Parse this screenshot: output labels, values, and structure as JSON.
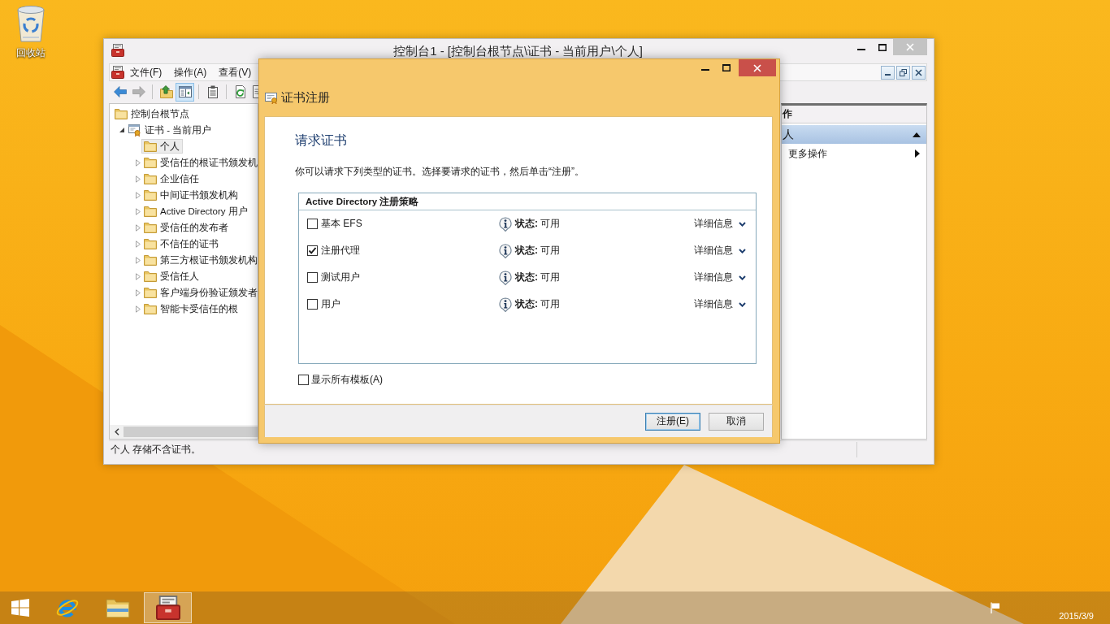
{
  "desktop": {
    "icons": [
      {
        "kind": "recycle_bin",
        "label": "回收站"
      }
    ]
  },
  "mmc_window": {
    "title": "控制台1 - [控制台根节点\\证书 - 当前用户\\个人]",
    "menu": [
      "文件(F)",
      "操作(A)",
      "查看(V)"
    ],
    "toolbar": [
      {
        "buttons": [
          {
            "kind": "back",
            "disabled": false,
            "pressed": false
          },
          {
            "kind": "forward",
            "disabled": true,
            "pressed": false
          }
        ]
      },
      {
        "buttons": [
          {
            "kind": "up",
            "disabled": false,
            "pressed": false
          },
          {
            "kind": "tree",
            "disabled": false,
            "pressed": true
          }
        ]
      },
      {
        "buttons": [
          {
            "kind": "properties",
            "disabled": false,
            "pressed": false
          }
        ]
      },
      {
        "buttons": [
          {
            "kind": "refresh",
            "disabled": false,
            "pressed": false
          },
          {
            "kind": "export",
            "disabled": false,
            "pressed": false
          }
        ]
      }
    ],
    "tree": [
      {
        "kind": "folder",
        "label": "控制台根节点",
        "selected": false,
        "children": [
          {
            "kind": "certificates",
            "label": "证书 - 当前用户",
            "expanded": true,
            "selected": false,
            "children": [
              {
                "kind": "folder",
                "label": "个人",
                "selected": true
              },
              {
                "kind": "folder",
                "label": "受信任的根证书颁发机",
                "expanded": false,
                "selected": false
              },
              {
                "kind": "folder",
                "label": "企业信任",
                "expanded": false,
                "selected": false
              },
              {
                "kind": "folder",
                "label": "中间证书颁发机构",
                "expanded": false,
                "selected": false
              },
              {
                "kind": "folder",
                "label": "Active Directory 用户",
                "expanded": false,
                "selected": false
              },
              {
                "kind": "folder",
                "label": "受信任的发布者",
                "expanded": false,
                "selected": false
              },
              {
                "kind": "folder",
                "label": "不信任的证书",
                "expanded": false,
                "selected": false
              },
              {
                "kind": "folder",
                "label": "第三方根证书颁发机构",
                "expanded": false,
                "selected": false
              },
              {
                "kind": "folder",
                "label": "受信任人",
                "expanded": false,
                "selected": false
              },
              {
                "kind": "folder",
                "label": "客户端身份验证颁发者",
                "expanded": false,
                "selected": false
              },
              {
                "kind": "folder",
                "label": "智能卡受信任的根",
                "expanded": false,
                "selected": false
              }
            ]
          }
        ]
      }
    ],
    "status": "个人 存储不含证书。",
    "actions": {
      "header": "作",
      "groups": [
        {
          "title": "人",
          "expanded": true,
          "items": [
            {
              "label": "更多操作",
              "submenu": true
            }
          ]
        }
      ]
    }
  },
  "dialog": {
    "title": "证书注册",
    "heading": "请求证书",
    "description": "你可以请求下列类型的证书。选择要请求的证书，然后单击“注册”。",
    "policy": "Active Directory 注册策略",
    "templates": [
      {
        "name": "基本 EFS",
        "checked": false,
        "status": "**状态:** 可用",
        "details": "详细信息"
      },
      {
        "name": "注册代理",
        "checked": true,
        "status": "**状态:** 可用",
        "details": "详细信息"
      },
      {
        "name": "测试用户",
        "checked": false,
        "status": "**状态:** 可用",
        "details": "详细信息"
      },
      {
        "name": "用户",
        "checked": false,
        "status": "**状态:** 可用",
        "details": "详细信息"
      }
    ],
    "show_all": {
      "label": "显示所有模板(A)",
      "checked": false
    },
    "buttons": [
      {
        "label": "注册(E)",
        "default": true
      },
      {
        "label": "取消",
        "default": false
      }
    ]
  },
  "taskbar": {
    "apps": [
      {
        "kind": "browser",
        "active": false
      },
      {
        "kind": "files",
        "active": false
      },
      {
        "kind": "console",
        "active": true
      }
    ],
    "date": "2015/3/9"
  }
}
